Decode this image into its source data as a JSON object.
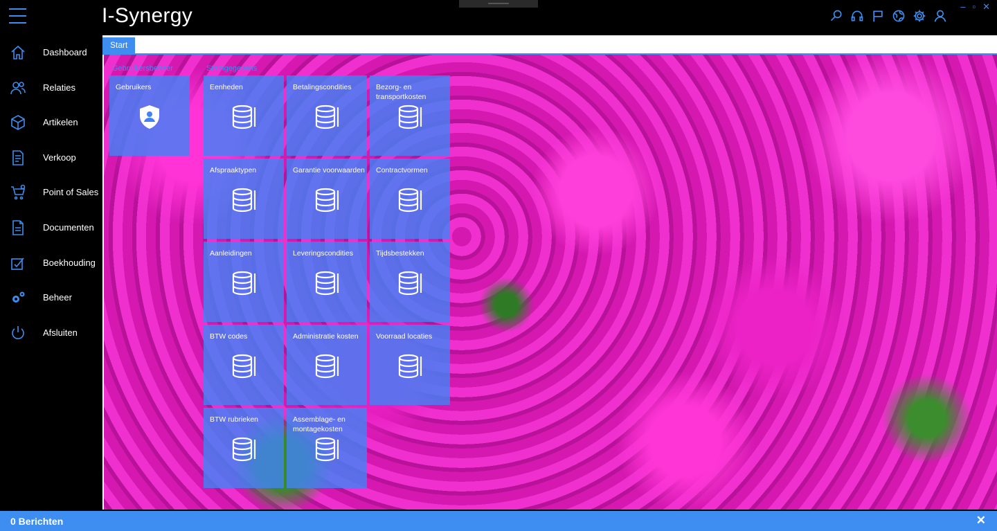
{
  "app": {
    "title": "I-Synergy"
  },
  "colors": {
    "accent": "#3d8ef0",
    "tile": "#4282f5",
    "background": "#000000"
  },
  "toolbar": {
    "icons": [
      "search-icon",
      "headset-icon",
      "flag-icon",
      "globe-icon",
      "gear-icon",
      "user-icon"
    ]
  },
  "window": {
    "minimize": "–",
    "maximize": "▫",
    "close": "✕"
  },
  "sidebar": {
    "items": [
      {
        "label": "Dashboard",
        "icon": "home-icon"
      },
      {
        "label": "Relaties",
        "icon": "users-icon"
      },
      {
        "label": "Artikelen",
        "icon": "box-icon"
      },
      {
        "label": "Verkoop",
        "icon": "invoice-icon"
      },
      {
        "label": "Point of Sales",
        "icon": "cart-icon"
      },
      {
        "label": "Documenten",
        "icon": "document-icon"
      },
      {
        "label": "Boekhouding",
        "icon": "ledger-icon"
      },
      {
        "label": "Beheer",
        "icon": "gears-icon"
      },
      {
        "label": "Afsluiten",
        "icon": "power-icon"
      }
    ]
  },
  "tabs": [
    {
      "label": "Start"
    }
  ],
  "groups": [
    {
      "label": "Gebruikersbeheer",
      "tiles": [
        {
          "label": "Gebruikers",
          "icon": "shield-user-icon"
        }
      ]
    },
    {
      "label": "Stamgegevens",
      "tiles": [
        {
          "label": "Eenheden",
          "icon": "database-icon"
        },
        {
          "label": "Betalingscondities",
          "icon": "database-icon"
        },
        {
          "label": "Bezorg- en transportkosten",
          "icon": "database-icon"
        },
        {
          "label": "Afspraaktypen",
          "icon": "database-icon"
        },
        {
          "label": "Garantie voorwaarden",
          "icon": "database-icon"
        },
        {
          "label": "Contractvormen",
          "icon": "database-icon"
        },
        {
          "label": "Aanleidingen",
          "icon": "database-icon"
        },
        {
          "label": "Leveringscondities",
          "icon": "database-icon"
        },
        {
          "label": "Tijdsbestekken",
          "icon": "database-icon"
        },
        {
          "label": "BTW codes",
          "icon": "database-icon"
        },
        {
          "label": "Administratie kosten",
          "icon": "database-icon"
        },
        {
          "label": "Voorraad locaties",
          "icon": "database-icon"
        },
        {
          "label": "BTW rubrieken",
          "icon": "database-icon"
        },
        {
          "label": "Assemblage- en montagekosten",
          "icon": "database-icon"
        }
      ]
    }
  ],
  "statusbar": {
    "messages": "0 Berichten",
    "close": "✕"
  }
}
